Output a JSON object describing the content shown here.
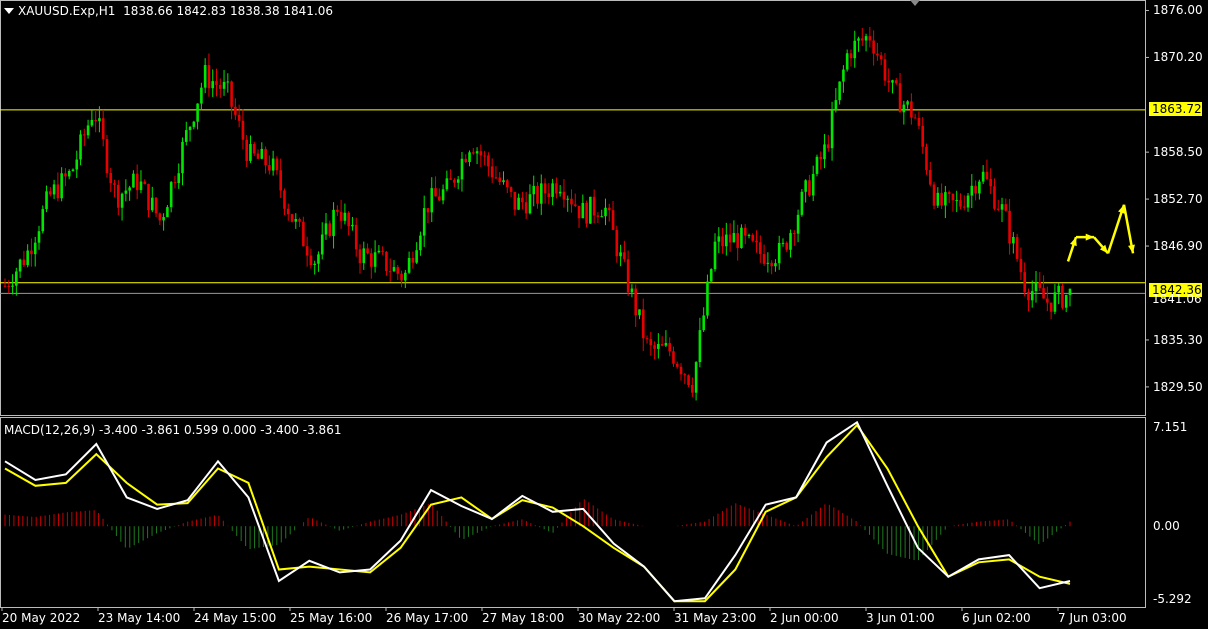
{
  "header": {
    "dropdown_icon": "dropdown-triangle-icon",
    "symbol": "XAUUSD.Exp,H1",
    "ohlc": "1838.66 1842.83 1838.38 1841.06"
  },
  "indicator": {
    "label": "MACD(12,26,9) -3.400 -3.861 0.599 0.000 -3.400 -3.861",
    "ticks": [
      "7.151",
      "0.00",
      "-5.292"
    ]
  },
  "price_axis": {
    "ticks": [
      "1876.00",
      "1870.20",
      "1858.50",
      "1852.70",
      "1846.90",
      "1835.30",
      "1829.50"
    ],
    "hlines": [
      {
        "label": "1863.72",
        "color": "#ffff00"
      },
      {
        "label": "1842.36",
        "color": "#ffff00"
      }
    ],
    "current_price": "1841.06"
  },
  "time_axis": {
    "ticks": [
      "20 May 2022",
      "23 May 14:00",
      "24 May 15:00",
      "25 May 16:00",
      "26 May 17:00",
      "27 May 18:00",
      "30 May 22:00",
      "31 May 23:00",
      "2 Jun 00:00",
      "3 Jun 01:00",
      "6 Jun 02:00",
      "7 Jun 03:00"
    ]
  },
  "colors": {
    "bull": "#00e600",
    "bear": "#e60000",
    "level": "#ffff00",
    "macd": "#ffffff",
    "signal": "#ffff00",
    "hist_pos": "#c80000",
    "hist_neg": "#1e7a1e"
  },
  "chart_data": {
    "type": "line",
    "path_close": [
      1842,
      1846,
      1853,
      1856,
      1864,
      1853,
      1855,
      1850,
      1859,
      1868,
      1866,
      1858,
      1857,
      1850,
      1845,
      1852,
      1846,
      1845,
      1843,
      1852,
      1854,
      1860,
      1856,
      1852,
      1853,
      1855,
      1851,
      1852,
      1843,
      1834,
      1834,
      1830,
      1847,
      1848,
      1846,
      1846,
      1853,
      1859,
      1871,
      1873,
      1866,
      1863,
      1852,
      1852,
      1856,
      1851,
      1842,
      1840,
      1841
    ],
    "macd": [
      4.5,
      3.2,
      3.6,
      5.7,
      2.0,
      1.2,
      1.8,
      4.5,
      2.0,
      -3.8,
      -2.4,
      -3.2,
      -3.0,
      -1.0,
      2.5,
      1.4,
      0.5,
      2.1,
      1.0,
      1.2,
      -1.2,
      -2.8,
      -5.2,
      -5.0,
      -2.0,
      1.5,
      2.0,
      5.8,
      7.2,
      2.8,
      -1.5,
      -3.5,
      -2.3,
      -2.0,
      -4.3,
      -3.8
    ],
    "signal": [
      4.0,
      2.8,
      3.0,
      5.0,
      3.0,
      1.5,
      1.6,
      4.0,
      3.0,
      -3.0,
      -2.8,
      -3.0,
      -3.2,
      -1.5,
      1.5,
      2.0,
      0.5,
      1.8,
      1.3,
      0.0,
      -1.5,
      -2.8,
      -5.2,
      -5.2,
      -3.0,
      1.0,
      2.0,
      4.8,
      7.0,
      4.0,
      0.0,
      -3.5,
      -2.5,
      -2.3,
      -3.5,
      -4.0
    ],
    "ylim_price": [
      1826.4,
      1876.8
    ],
    "ylim_macd": [
      -5.6,
      7.5
    ],
    "projection_arrows": [
      1845,
      1848,
      1848,
      1846,
      1852,
      1846,
      1853
    ]
  }
}
